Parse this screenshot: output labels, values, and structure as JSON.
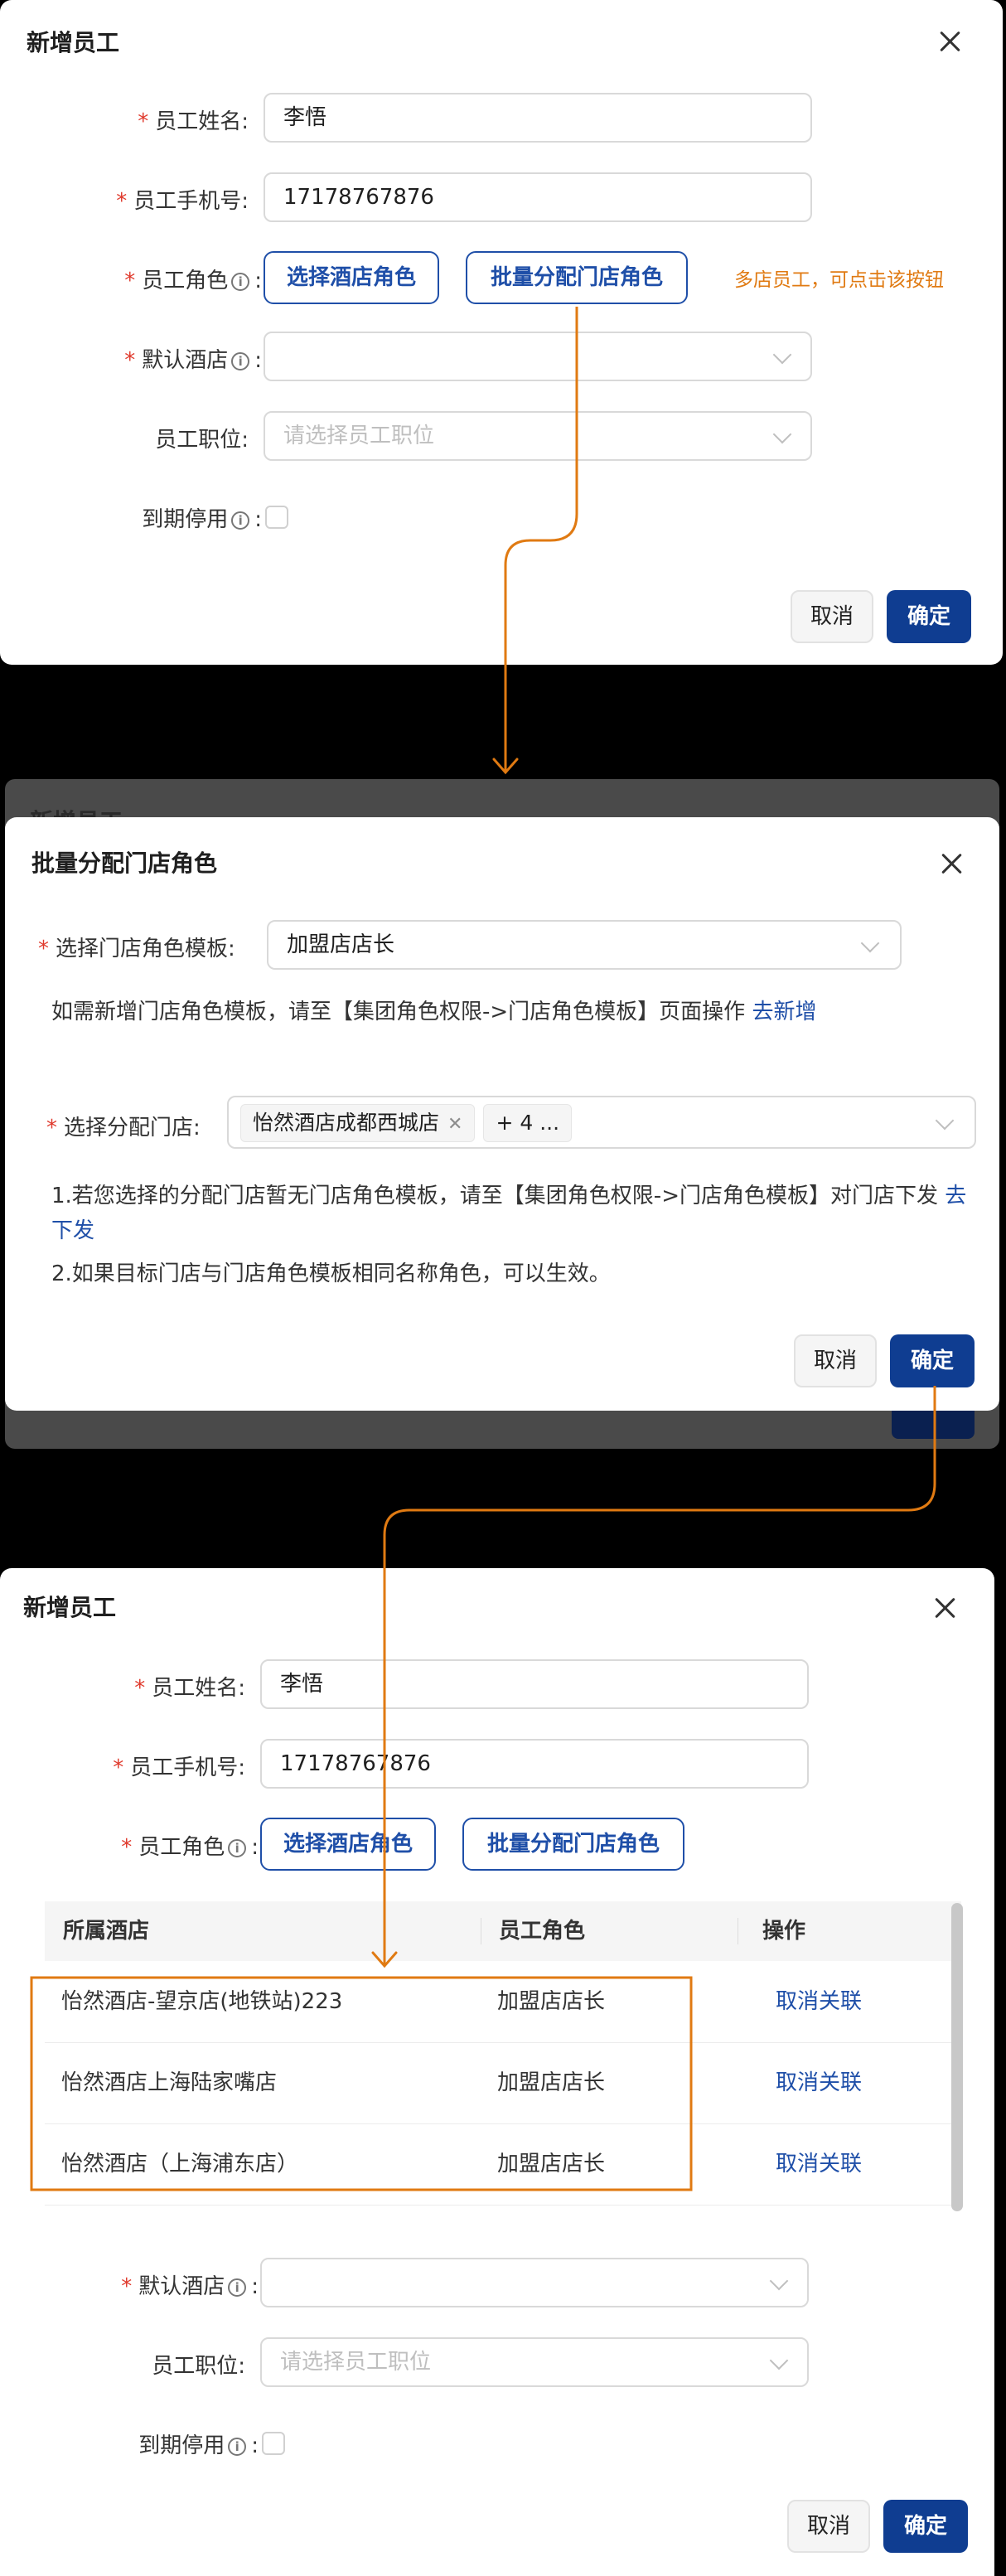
{
  "panel1": {
    "title": "新增员工",
    "fields": {
      "name_label": "员工姓名:",
      "name_value": "李悟",
      "phone_label": "员工手机号:",
      "phone_value": "17178767876",
      "role_label": "员工角色",
      "select_hotel_role_button": "选择酒店角色",
      "batch_assign_button": "批量分配门店角色",
      "role_hint": "多店员工，可点击该按钮",
      "default_hotel_label": "默认酒店",
      "position_label": "员工职位:",
      "position_placeholder": "请选择员工职位",
      "expire_label": "到期停用"
    },
    "cancel": "取消",
    "ok": "确定"
  },
  "panel2": {
    "behind_title": "新增员工",
    "title": "批量分配门店角色",
    "template_label": "选择门店角色模板:",
    "template_value": "加盟店店长",
    "template_note": "如需新增门店角色模板，请至【集团角色权限->门店角色模板】页面操作",
    "template_link": "去新增",
    "stores_label": "选择分配门店:",
    "store_tag": "怡然酒店成都西城店",
    "more_tag": "+ 4 ...",
    "note1": "1.若您选择的分配门店暂无门店角色模板，请至【集团角色权限->门店角色模板】对门店下发",
    "note1_link": "去下发",
    "note2": "2.如果目标门店与门店角色模板相同名称角色，可以生效。",
    "cancel": "取消",
    "ok": "确定"
  },
  "panel3": {
    "title": "新增员工",
    "name_label": "员工姓名:",
    "name_value": "李悟",
    "phone_label": "员工手机号:",
    "phone_value": "17178767876",
    "role_label": "员工角色",
    "select_hotel_role_button": "选择酒店角色",
    "batch_assign_button": "批量分配门店角色",
    "table": {
      "headers": [
        "所属酒店",
        "员工角色",
        "操作"
      ],
      "rows": [
        {
          "hotel": "怡然酒店-望京店(地铁站)223",
          "role": "加盟店店长",
          "action": "取消关联"
        },
        {
          "hotel": "怡然酒店上海陆家嘴店",
          "role": "加盟店店长",
          "action": "取消关联"
        },
        {
          "hotel": "怡然酒店（上海浦东店）",
          "role": "加盟店店长",
          "action": "取消关联"
        }
      ]
    },
    "default_hotel_label": "默认酒店",
    "position_label": "员工职位:",
    "position_placeholder": "请选择员工职位",
    "expire_label": "到期停用",
    "cancel": "取消",
    "ok": "确定"
  },
  "colors": {
    "primary": "#0f3d91",
    "link": "#1f4fa8",
    "annotation": "#e07a12",
    "required": "#e03b2e"
  }
}
